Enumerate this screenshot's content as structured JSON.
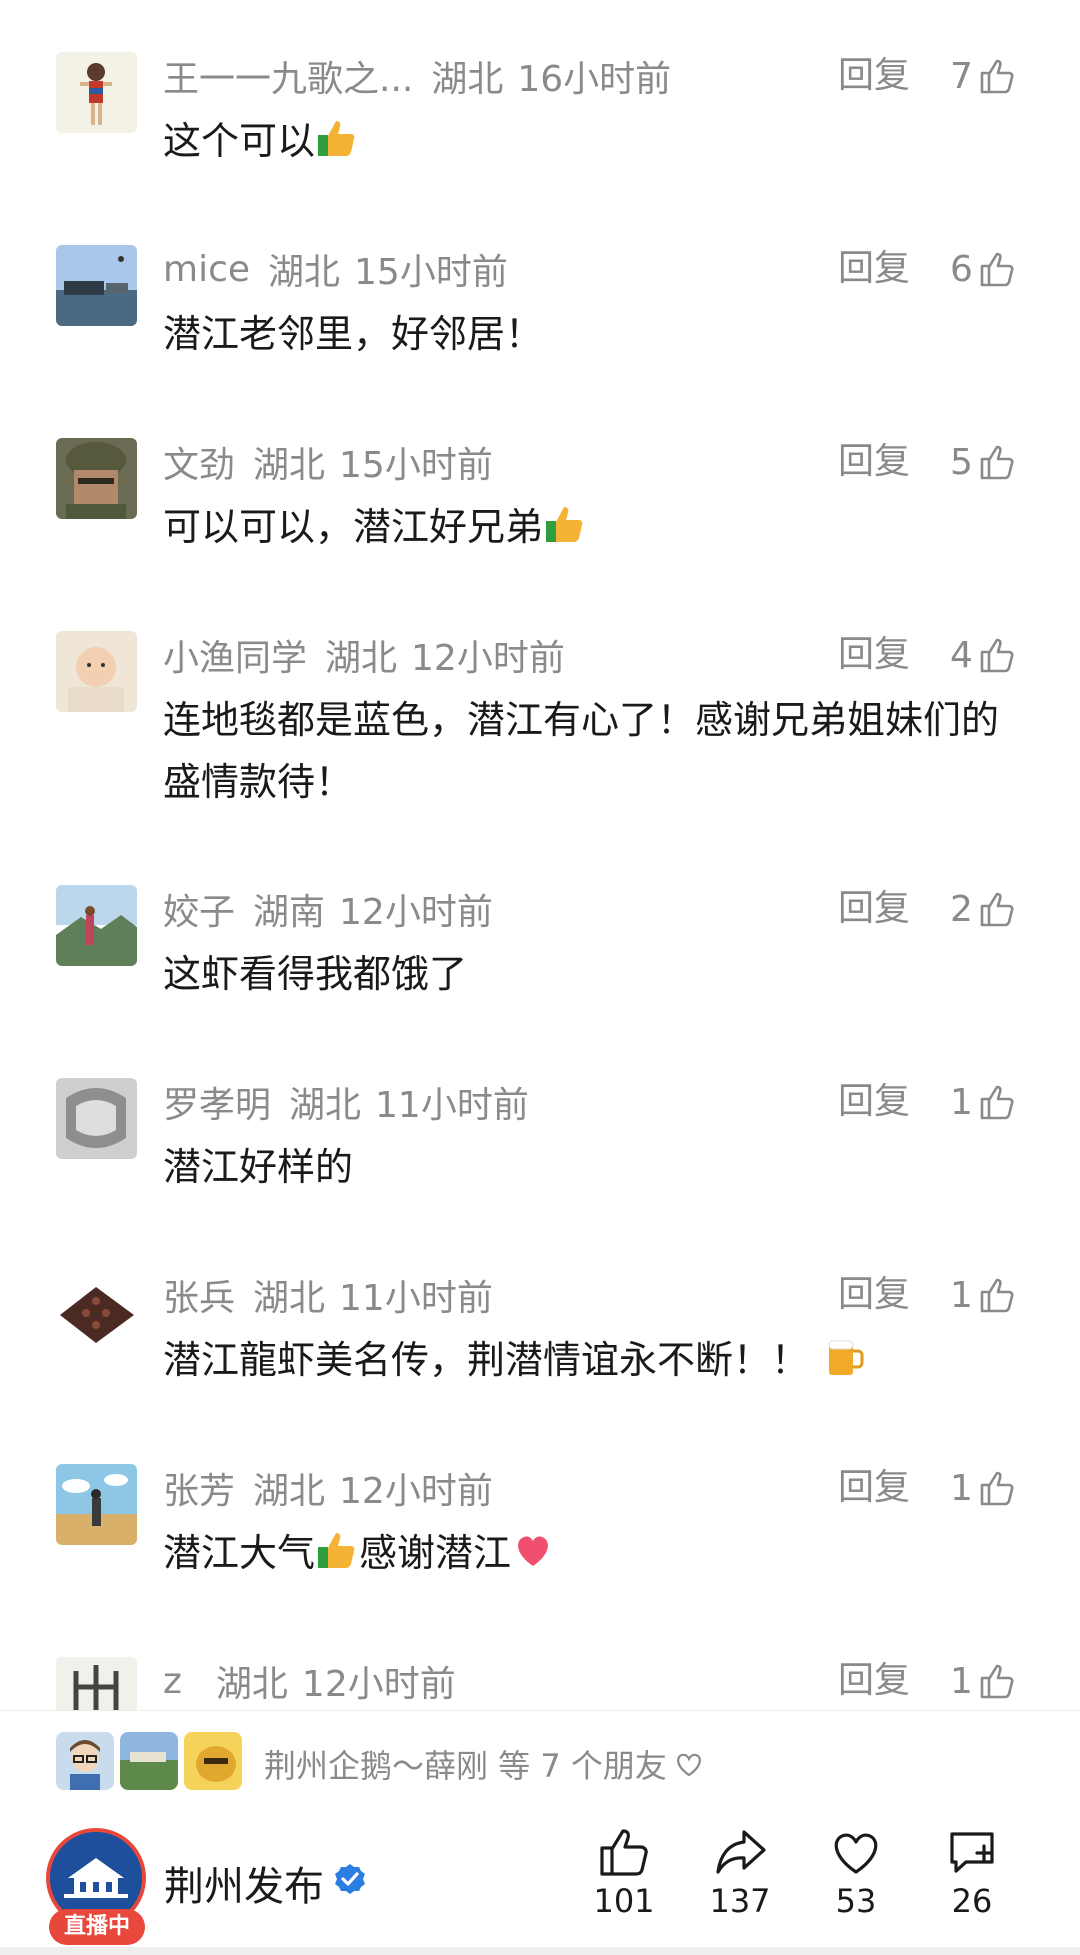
{
  "comments": [
    {
      "nick": "王一一九歌之...",
      "loc": "湖北",
      "time": "16小时前",
      "text": "这个可以",
      "emoji": "thumbs-up",
      "reply": "回复",
      "likes": "7",
      "avatar": "avatar-wonderwoman"
    },
    {
      "nick": "mice",
      "loc": "湖北",
      "time": "15小时前",
      "text": "潜江老邻里，好邻居！",
      "emoji": "",
      "reply": "回复",
      "likes": "6",
      "avatar": "avatar-harbor"
    },
    {
      "nick": "文劲",
      "loc": "湖北",
      "time": "15小时前",
      "text": "可以可以，潜江好兄弟",
      "emoji": "thumbs-up",
      "reply": "回复",
      "likes": "5",
      "avatar": "avatar-soldier"
    },
    {
      "nick": "小渔同学",
      "loc": "湖北",
      "time": "12小时前",
      "text": "连地毯都是蓝色，潜江有心了！感谢兄弟姐妹们的盛情款待！",
      "emoji": "",
      "reply": "回复",
      "likes": "4",
      "avatar": "avatar-baby"
    },
    {
      "nick": "姣子",
      "loc": "湖南",
      "time": "12小时前",
      "text": "这虾看得我都饿了",
      "emoji": "",
      "reply": "回复",
      "likes": "2",
      "avatar": "avatar-mountain"
    },
    {
      "nick": "罗孝明",
      "loc": "湖北",
      "time": "11小时前",
      "text": "潜江好样的",
      "emoji": "",
      "reply": "回复",
      "likes": "1",
      "avatar": "avatar-car"
    },
    {
      "nick": "张兵",
      "loc": "湖北",
      "time": "11小时前",
      "text": "潜江龍虾美名传，荆潜情谊永不断！！",
      "emoji": "beer",
      "reply": "回复",
      "likes": "1",
      "avatar": "avatar-board"
    },
    {
      "nick": "张芳",
      "loc": "湖北",
      "time": "12小时前",
      "text": "潜江大气",
      "emoji": "thumbs-up",
      "text2": "感谢潜江",
      "emoji2": "heart",
      "reply": "回复",
      "likes": "1",
      "avatar": "avatar-anime"
    },
    {
      "nick": "z",
      "loc": "湖北",
      "time": "12小时前",
      "text": "",
      "emoji": "",
      "reply": "回复",
      "likes": "1",
      "avatar": "avatar-calligraphy"
    }
  ],
  "social": {
    "friends_text": "荆州企鹅～薛刚 等 7 个朋友",
    "icon": "heart-outline-icon"
  },
  "account": {
    "name": "荆州发布",
    "live_badge": "直播中",
    "verified_icon": "verified-check-icon"
  },
  "actions": {
    "like_count": "101",
    "share_count": "137",
    "favorite_count": "53",
    "comment_count": "26"
  },
  "colors": {
    "accent_red": "#e8483b",
    "verified_blue": "#2a7de1",
    "meta_gray": "#8a8a8a"
  }
}
